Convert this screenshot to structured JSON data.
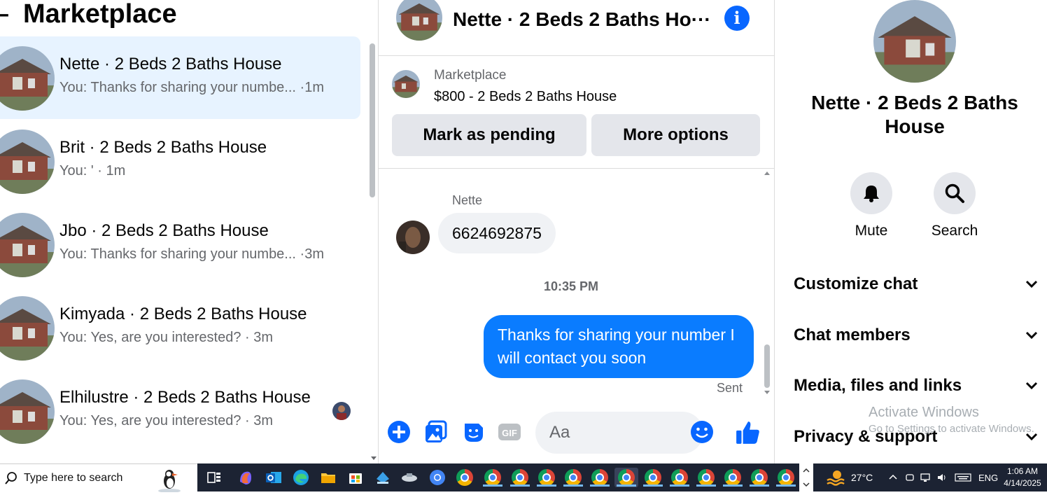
{
  "left": {
    "title": "Marketplace",
    "back_glyph": "–",
    "conversations": [
      {
        "name": "Nette · 2 Beds 2 Baths House",
        "preview": "You: Thanks for sharing your numbe... ·1m",
        "active": true
      },
      {
        "name": "Brit · 2 Beds 2 Baths House",
        "preview": "You: ' · 1m"
      },
      {
        "name": "Jbo · 2 Beds 2 Baths House",
        "preview": "You: Thanks for sharing your numbe... ·3m"
      },
      {
        "name": "Kimyada · 2 Beds 2 Baths House",
        "preview": "You: Yes, are you interested? · 3m"
      },
      {
        "name": "Elhilustre · 2 Beds 2 Baths House",
        "preview": "You: Yes, are you interested? · 3m"
      }
    ]
  },
  "chat": {
    "title": "Nette · 2 Beds 2 Baths Ho···",
    "info_glyph": "i",
    "listing": {
      "label": "Marketplace",
      "price_title": "$800 - 2 Beds 2 Baths House",
      "mark_pending": "Mark as pending",
      "more_options": "More options"
    },
    "messages": {
      "sender": "Nette",
      "incoming": "6624692875",
      "timestamp": "10:35 PM",
      "outgoing": "Thanks for sharing your number I will contact you soon",
      "status": "Sent"
    },
    "composer": {
      "placeholder": "Aa",
      "gif_label": "GIF"
    }
  },
  "details": {
    "name": "Nette · 2 Beds 2 Baths House",
    "mute_label": "Mute",
    "search_label": "Search",
    "sections": [
      "Customize chat",
      "Chat members",
      "Media, files and links",
      "Privacy & support"
    ],
    "watermark_title": "Activate Windows",
    "watermark_sub": "Go to Settings to activate Windows."
  },
  "taskbar": {
    "search_placeholder": "Type here to search",
    "weather": "27°C",
    "lang": "ENG",
    "time": "1:06 AM",
    "date": "4/14/2025"
  },
  "colors": {
    "accent": "#0866ff",
    "outgoing_bubble": "#0a7cff",
    "active_row": "#e7f3ff"
  }
}
